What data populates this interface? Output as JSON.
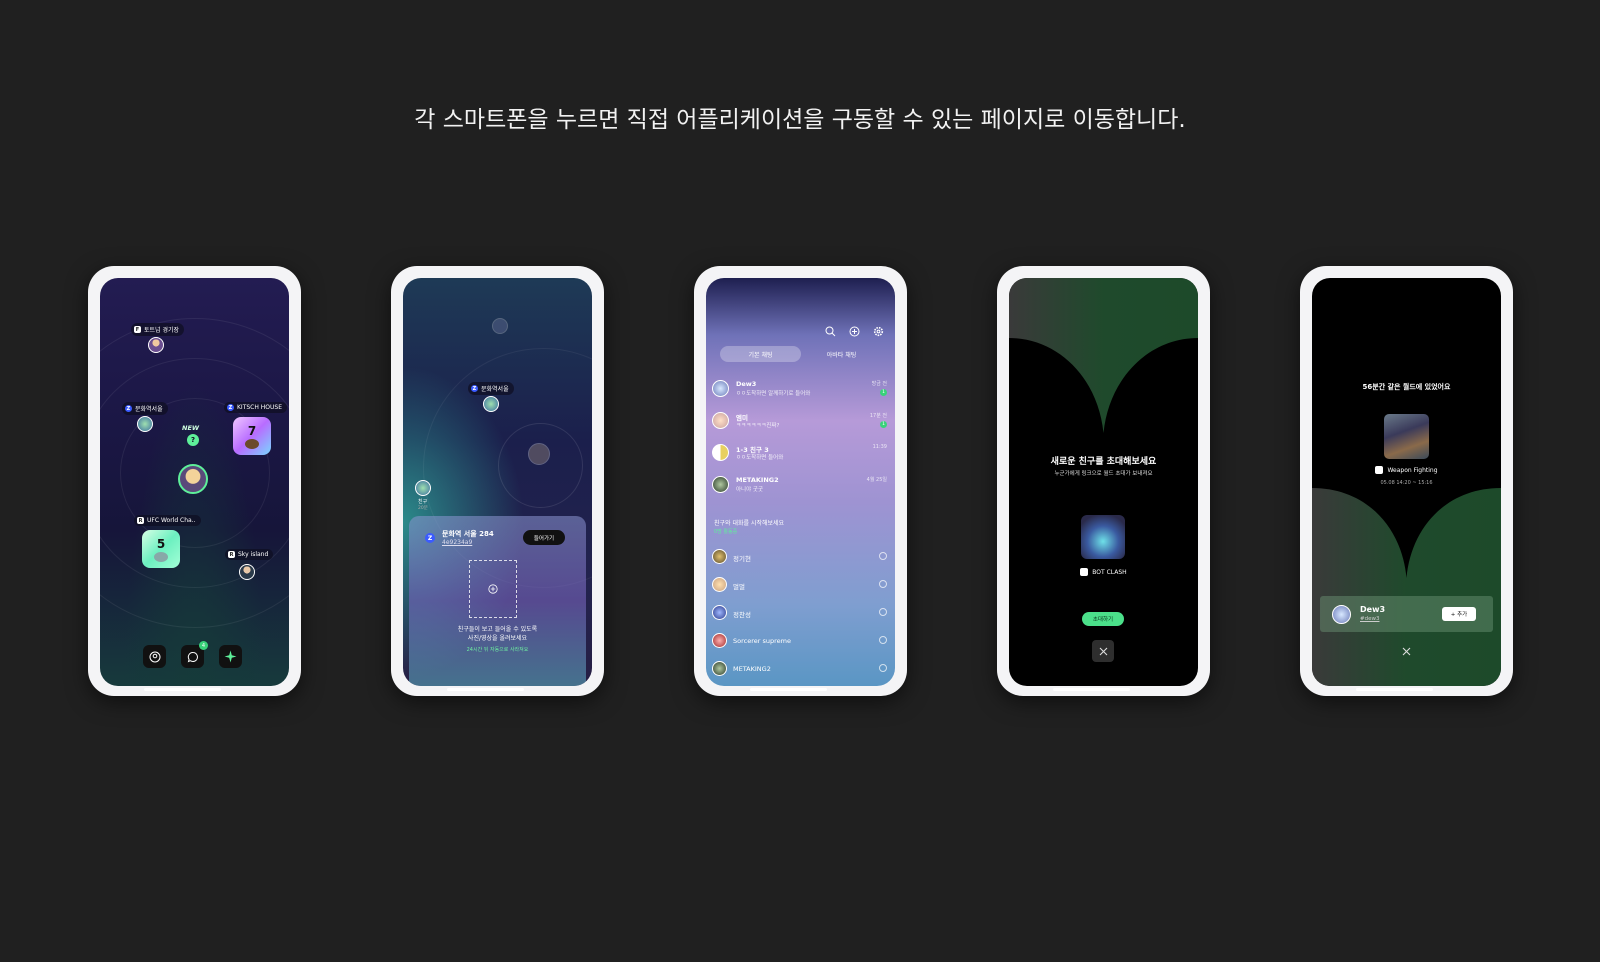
{
  "headline": "각 스마트폰을 누르면 직접 어플리케이션을 구동할 수 있는 페이지로 이동합니다.",
  "phone1": {
    "worlds": [
      {
        "label": "토트넘 경기장"
      },
      {
        "label": "문화역서울"
      },
      {
        "label": "KITSCH HOUSE"
      },
      {
        "label": "UFC World Cha.."
      },
      {
        "label": "Sky island"
      }
    ],
    "new_label": "NEW",
    "new_mark": "?",
    "badge_kitsch": "7",
    "badge_ufc": "5",
    "chat_unread": "4"
  },
  "phone2": {
    "world_label": "문화역서울",
    "friend_label": "친구",
    "friend_sub": "20분",
    "sheet_title": "문화역 서울 284",
    "sheet_code": "4e9234a9",
    "enter_button": "들어가기",
    "hint_line1": "친구들이 보고 들어올 수 있도록",
    "hint_line2": "사진/영상을 올려보세요",
    "hint_sub": "24시간 뒤 자동으로 사라져요"
  },
  "phone3": {
    "tabs": [
      "기본 채팅",
      "아바타 채팅"
    ],
    "chats": [
      {
        "name": "Dew3",
        "msg": "ㅇㅇ도착하면 알께하기로 들어와",
        "time": "방금 전",
        "unread": "1"
      },
      {
        "name": "엠미",
        "msg": "ㅋㅋㅋㅋㅋㅋ진짜?",
        "time": "17분 전",
        "unread": "1"
      },
      {
        "name": "1-3 친구 3",
        "msg": "ㅇㅇ도착하면 들어와",
        "time": "11:39",
        "unread": ""
      },
      {
        "name": "METAKING2",
        "msg": "아니야 굿굿",
        "time": "4월 25일",
        "unread": ""
      }
    ],
    "suggest_title": "친구와 대화를 시작해보세요",
    "suggest_sub": "0명 활동중",
    "friends": [
      "정기현",
      "멀멀",
      "정찬성",
      "Sorcerer supreme",
      "METAKING2"
    ]
  },
  "phone4": {
    "title": "새로운 친구를 초대해보세요",
    "subtitle": "누군가에게 링크으로 월드 초대가 보내져요",
    "world_name": "BOT CLASH",
    "invite_button": "초대하기"
  },
  "phone5": {
    "title": "56분간 같은 월드에 있었어요",
    "world_name": "Weapon Fighting",
    "time_range": "05.08 14:20 ~ 15:16",
    "friend_name": "Dew3",
    "friend_id": "#dew3",
    "add_button": "+ 추가"
  },
  "colors": {
    "background": "#202020",
    "accent_green": "#4be08a",
    "dark_green": "#1f4a2c"
  }
}
